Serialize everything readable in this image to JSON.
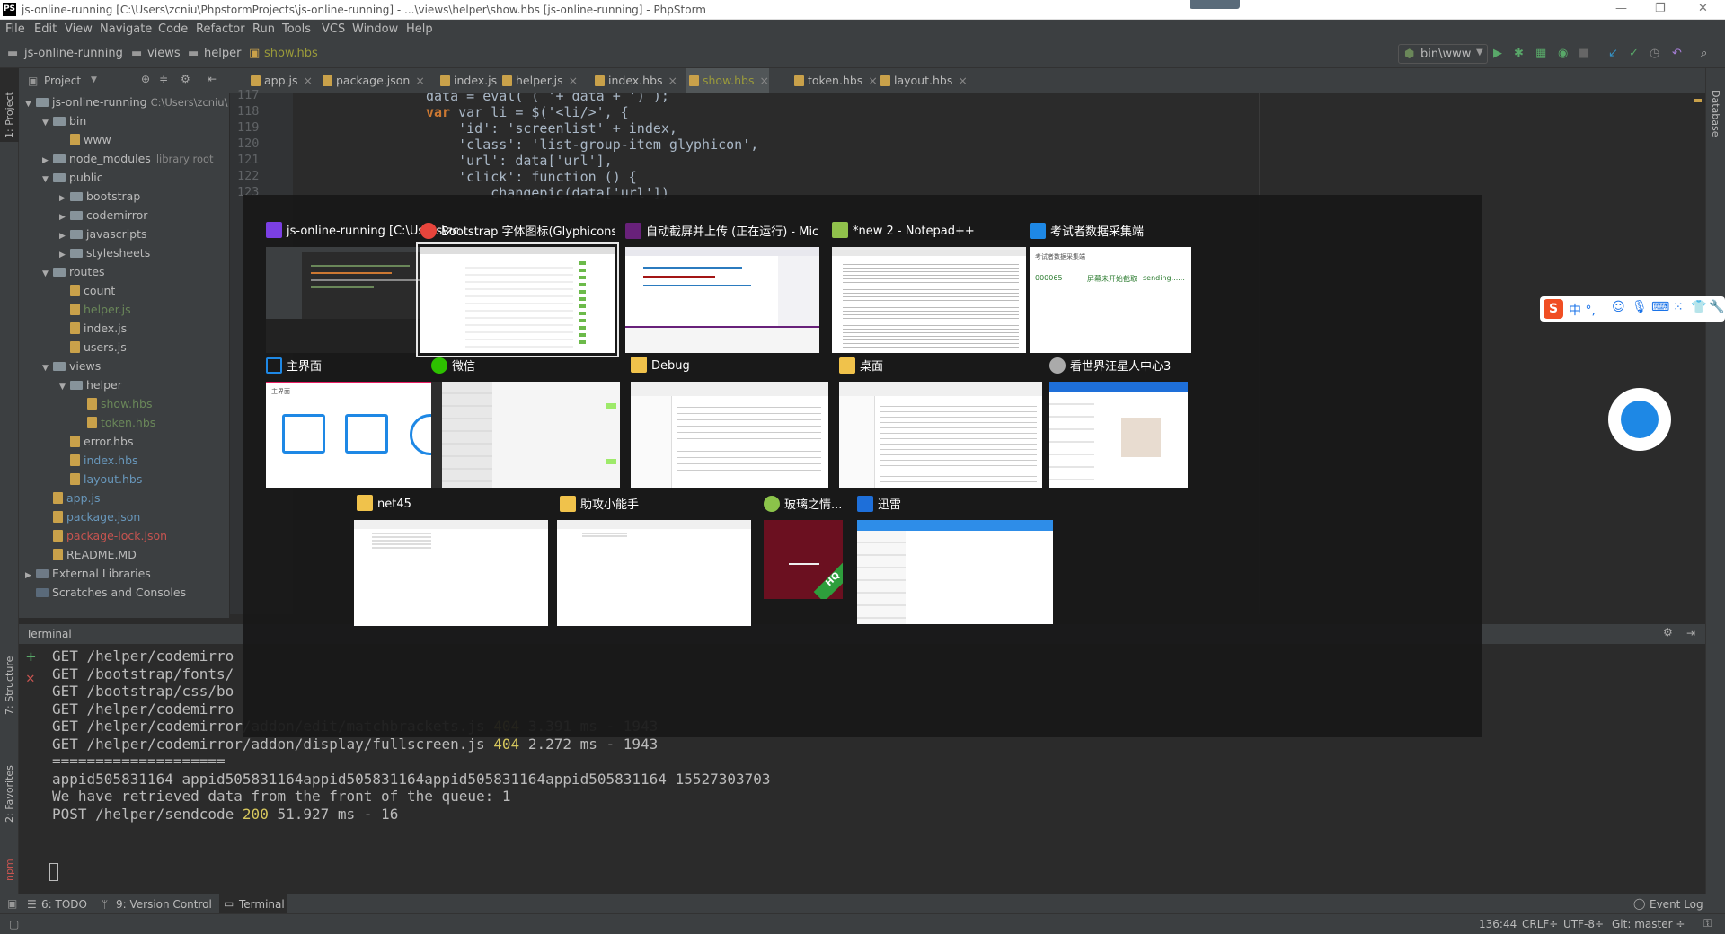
{
  "window": {
    "title": "js-online-running [C:\\Users\\zcniu\\PhpstormProjects\\js-online-running] - ...\\views\\helper\\show.hbs [js-online-running] - PhpStorm",
    "app_icon": "PS"
  },
  "menu": [
    "File",
    "Edit",
    "View",
    "Navigate",
    "Code",
    "Refactor",
    "Run",
    "Tools",
    "VCS",
    "Window",
    "Help"
  ],
  "breadcrumbs": [
    "js-online-running",
    "views",
    "helper",
    "show.hbs"
  ],
  "run_config": "bin\\www",
  "left_tools": [
    "1: Project",
    "7: Structure",
    "2: Favorites",
    "npm"
  ],
  "right_tools": [
    "Database"
  ],
  "project": {
    "header": "Project",
    "root": "js-online-running",
    "root_path": "C:\\Users\\zcniu\\",
    "items": [
      {
        "name": "bin",
        "type": "folder",
        "depth": 1,
        "open": true
      },
      {
        "name": "www",
        "type": "file",
        "depth": 2
      },
      {
        "name": "node_modules",
        "type": "folder",
        "depth": 1,
        "open": false,
        "note": "library root"
      },
      {
        "name": "public",
        "type": "folder",
        "depth": 1,
        "open": true
      },
      {
        "name": "bootstrap",
        "type": "folder",
        "depth": 2,
        "open": false
      },
      {
        "name": "codemirror",
        "type": "folder",
        "depth": 2,
        "open": false
      },
      {
        "name": "javascripts",
        "type": "folder",
        "depth": 2,
        "open": false
      },
      {
        "name": "stylesheets",
        "type": "folder",
        "depth": 2,
        "open": false
      },
      {
        "name": "routes",
        "type": "folder",
        "depth": 1,
        "open": true
      },
      {
        "name": "count",
        "type": "file",
        "depth": 2
      },
      {
        "name": "helper.js",
        "type": "file",
        "depth": 2,
        "color": "#6a8759"
      },
      {
        "name": "index.js",
        "type": "file",
        "depth": 2
      },
      {
        "name": "users.js",
        "type": "file",
        "depth": 2
      },
      {
        "name": "views",
        "type": "folder",
        "depth": 1,
        "open": true
      },
      {
        "name": "helper",
        "type": "folder",
        "depth": 2,
        "open": true
      },
      {
        "name": "show.hbs",
        "type": "file",
        "depth": 3,
        "color": "#6a8759"
      },
      {
        "name": "token.hbs",
        "type": "file",
        "depth": 3,
        "color": "#6a8759"
      },
      {
        "name": "error.hbs",
        "type": "file",
        "depth": 2
      },
      {
        "name": "index.hbs",
        "type": "file",
        "depth": 2,
        "color": "#6897bb"
      },
      {
        "name": "layout.hbs",
        "type": "file",
        "depth": 2,
        "color": "#6897bb"
      },
      {
        "name": "app.js",
        "type": "file",
        "depth": 1,
        "color": "#6897bb"
      },
      {
        "name": "package.json",
        "type": "file",
        "depth": 1,
        "color": "#6897bb"
      },
      {
        "name": "package-lock.json",
        "type": "file",
        "depth": 1,
        "color": "#c75450"
      },
      {
        "name": "README.MD",
        "type": "file",
        "depth": 1
      },
      {
        "name": "External Libraries",
        "type": "lib",
        "depth": 0
      },
      {
        "name": "Scratches and Consoles",
        "type": "scratch",
        "depth": 0
      }
    ]
  },
  "tabs": [
    {
      "label": "app.js",
      "active": false
    },
    {
      "label": "package.json",
      "active": false
    },
    {
      "label": "index.js",
      "active": false
    },
    {
      "label": "helper.js",
      "active": false
    },
    {
      "label": "index.hbs",
      "active": false
    },
    {
      "label": "show.hbs",
      "active": true
    },
    {
      "label": "token.hbs",
      "active": false
    },
    {
      "label": "layout.hbs",
      "active": false
    }
  ],
  "gutter": [
    "117",
    "118",
    "119",
    "120",
    "121",
    "122",
    "123"
  ],
  "code": [
    "data = eval( ( '+ data + ') );",
    "var li = $('<li/>', {",
    "    'id': 'screenlist' + index,",
    "    'class': 'list-group-item glyphicon',",
    "    'url': data['url'],",
    "    'click': function () {",
    "        changepic(data['url'])"
  ],
  "terminal": {
    "title": "Terminal",
    "lines": [
      {
        "text": "GET /helper/codemirro",
        "num": "",
        "rest": ""
      },
      {
        "text": "GET /bootstrap/fonts/",
        "num": "",
        "rest": ""
      },
      {
        "text": "GET /bootstrap/css/bo",
        "num": "",
        "rest": ""
      },
      {
        "text": "GET /helper/codemirro",
        "num": "",
        "rest": ""
      },
      {
        "text": "GET /helper/codemirror/addon/edit/matchbrackets.js ",
        "num": "404",
        "rest": " 3.391 ms - 1943"
      },
      {
        "text": "GET /helper/codemirror/addon/display/fullscreen.js ",
        "num": "404",
        "rest": " 2.272 ms - 1943"
      },
      {
        "text": "====================",
        "num": "",
        "rest": ""
      },
      {
        "text": "appid505831164 appid505831164appid505831164appid505831164appid505831164 15527303703",
        "num": "",
        "rest": ""
      },
      {
        "text": "We have retrieved data from the front of the queue: 1",
        "num": "",
        "rest": ""
      },
      {
        "text": "POST /helper/sendcode ",
        "num": "200",
        "rest": " 51.927 ms - 16"
      }
    ]
  },
  "bottom_tabs": [
    "6: TODO",
    "9: Version Control",
    "Terminal"
  ],
  "event_log": "Event Log",
  "status": {
    "position": "136:44",
    "line_sep": "CRLF÷",
    "encoding": "UTF-8÷",
    "git": "Git: master ÷"
  },
  "switcher": {
    "row1": [
      {
        "title": "js-online-running [C:\\Users\\zcniu\\...",
        "icon_color": "#7b3fe4",
        "selected": false
      },
      {
        "title": "Bootstrap 字体图标(Glyphicons) |...",
        "icon_color": "#e8453c",
        "selected": true
      },
      {
        "title": "自动截屏并上传 (正在运行) - Micros...",
        "icon_color": "#68217a",
        "selected": false
      },
      {
        "title": "*new 2 - Notepad++",
        "icon_color": "#90c14b",
        "selected": false
      },
      {
        "title": "考试者数据采集端",
        "icon_color": "#1e88e5",
        "selected": false
      }
    ],
    "row2": [
      {
        "title": "主界面",
        "icon_color": "#1e88e5"
      },
      {
        "title": "微信",
        "icon_color": "#2dc100"
      },
      {
        "title": "Debug",
        "icon_color": "#f0c24b"
      },
      {
        "title": "桌面",
        "icon_color": "#f0c24b"
      },
      {
        "title": "看世界汪星人中心3",
        "icon_color": "#aaaaaa"
      }
    ],
    "row3": [
      {
        "title": "net45",
        "icon_color": "#f0c24b"
      },
      {
        "title": "助攻小能手",
        "icon_color": "#f0c24b"
      },
      {
        "title": "玻璃之情...",
        "icon_color": "#8bc34a"
      },
      {
        "title": "迅雷",
        "icon_color": "#1e6fd9"
      }
    ],
    "kaoshi": {
      "title": "考试者数据采集端",
      "id": "000065",
      "status1": "屏幕未开始截取",
      "status2": "sending......"
    },
    "main_title": "主界面",
    "badge": "HQ"
  },
  "ime": {
    "brand": "S",
    "text": "中 °,"
  }
}
